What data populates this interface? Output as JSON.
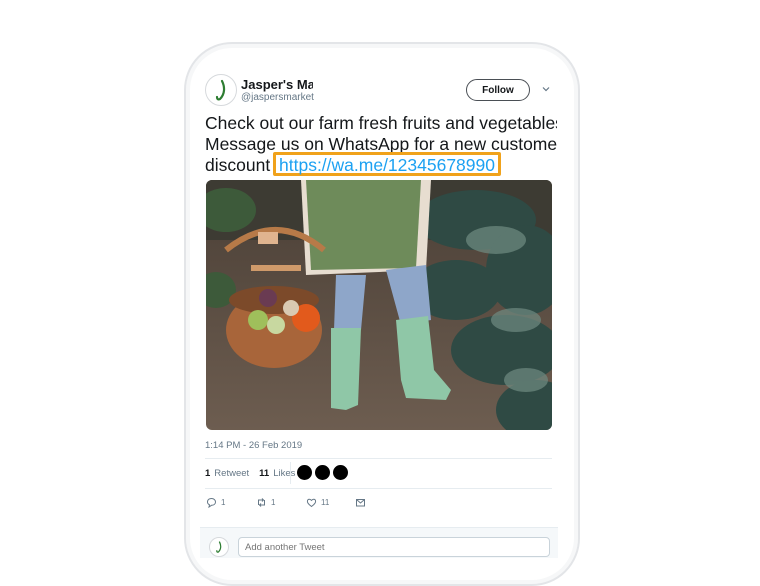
{
  "profile": {
    "name": "Jasper's Market",
    "handle": "@jaspersmarket",
    "avatar_icon": "jasper-logo-icon"
  },
  "follow_label": "Follow",
  "tweet": {
    "line1": "Check out our farm fresh fruits and vegetables!",
    "line2": "Message us on WhatsApp for a new customer",
    "line3_prefix": "discount",
    "link": "https://wa.me/12345678990",
    "timestamp": "1:14 PM - 26 Feb 2019"
  },
  "stats": {
    "retweets": "1",
    "retweets_label": "Retweet",
    "likes": "11",
    "likes_label": "Likes"
  },
  "actions": {
    "reply_count": "1",
    "retweet_count": "1",
    "like_count": "11"
  },
  "reply": {
    "placeholder": "Add another Tweet"
  },
  "colors": {
    "link": "#1da1f2",
    "highlight": "#f0a21b",
    "logo_green": "#2e7d32"
  }
}
